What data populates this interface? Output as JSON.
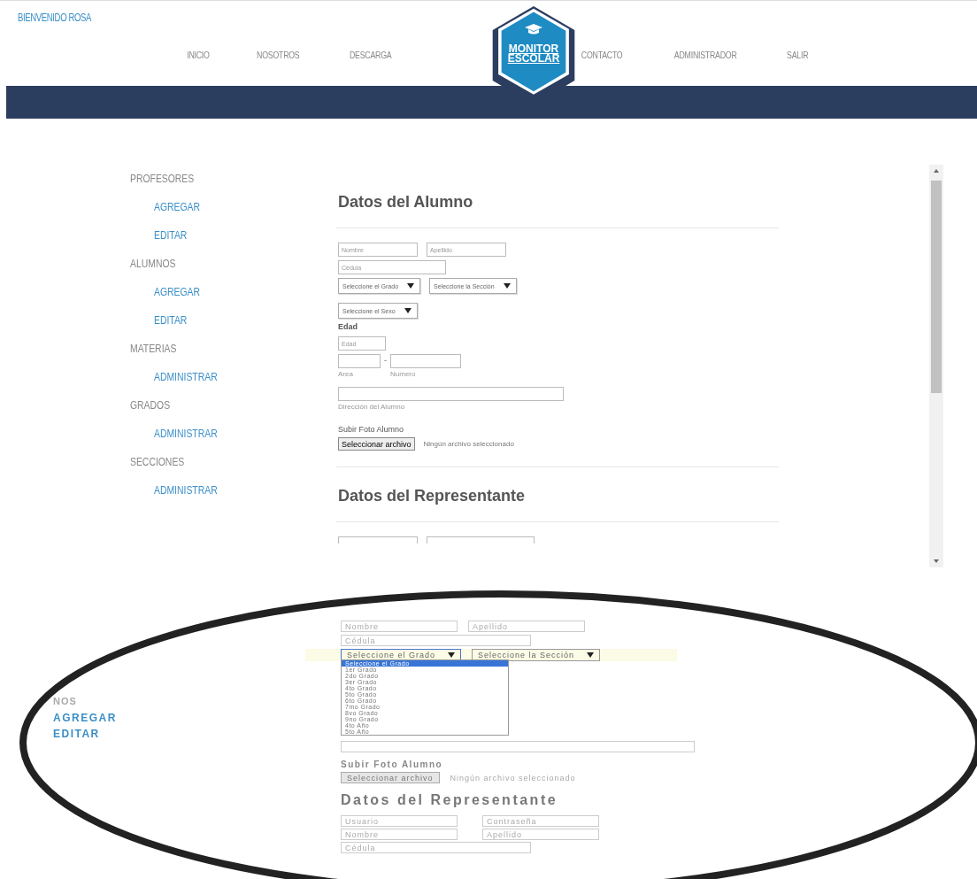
{
  "header": {
    "greeting": "BIENVENIDO ROSA",
    "nav_left": [
      {
        "label": "INICIO"
      },
      {
        "label": "NOSOTROS"
      },
      {
        "label": "DESCARGA"
      }
    ],
    "logo": {
      "line1": "MONITOR",
      "line2": "ESCOLAR"
    },
    "nav_right": [
      {
        "label": "CONTACTO"
      },
      {
        "label": "ADMINISTRADOR"
      },
      {
        "label": "SALIR"
      }
    ]
  },
  "sidebar": [
    {
      "label": "PROFESORES",
      "children": [
        {
          "label": "AGREGAR"
        },
        {
          "label": "EDITAR"
        }
      ]
    },
    {
      "label": "ALUMNOS",
      "children": [
        {
          "label": "AGREGAR"
        },
        {
          "label": "EDITAR"
        }
      ]
    },
    {
      "label": "MATERIAS",
      "children": [
        {
          "label": "ADMINISTRAR"
        }
      ]
    },
    {
      "label": "GRADOS",
      "children": [
        {
          "label": "ADMINISTRAR"
        }
      ]
    },
    {
      "label": "SECCIONES",
      "children": [
        {
          "label": "ADMINISTRAR"
        }
      ]
    }
  ],
  "form": {
    "student_title": "Datos del Alumno",
    "name_fields": [
      {
        "placeholder": "Nombre"
      },
      {
        "placeholder": "Apellido"
      }
    ],
    "id_field": {
      "placeholder": "Cédula"
    },
    "selects": [
      {
        "value": "Seleccione el Grado"
      },
      {
        "value": "Seleccione la Sección"
      }
    ],
    "sex_select": {
      "value": "Seleccione el Sexo"
    },
    "age_label": "Edad",
    "age_field": {
      "placeholder": "Edad"
    },
    "phone_fields": [
      {
        "caption": "Area"
      },
      {
        "caption": "Numero"
      }
    ],
    "phone_separator": "-",
    "address_field": {
      "caption": "Dirección del Alumno"
    },
    "photo_label": "Subir Foto Alumno",
    "file_button": "Seleccionar archivo",
    "file_status": "Ningún archivo seleccionado",
    "rep_title": "Datos del Representante"
  },
  "callout": {
    "sidebar_items": [
      {
        "label": "NOS",
        "kind": "section"
      },
      {
        "label": "AGREGAR",
        "kind": "link"
      },
      {
        "label": "EDITAR",
        "kind": "link"
      }
    ],
    "name_fields": [
      {
        "placeholder": "Nombre"
      },
      {
        "placeholder": "Apellido"
      }
    ],
    "id_field": {
      "placeholder": "Cédula"
    },
    "selects": [
      {
        "value": "Seleccione el Grado",
        "expanded": true
      },
      {
        "value": "Seleccione la Sección",
        "expanded": false
      }
    ],
    "options": [
      {
        "label": "Seleccione el Grado",
        "selected": true
      },
      {
        "label": "1er Grado",
        "selected": false
      },
      {
        "label": "2do Grado",
        "selected": false
      },
      {
        "label": "3er Grado",
        "selected": false
      },
      {
        "label": "4to Grado",
        "selected": false
      },
      {
        "label": "5to Grado",
        "selected": false
      },
      {
        "label": "6to Grado",
        "selected": false
      },
      {
        "label": "7mo Grado",
        "selected": false
      },
      {
        "label": "8vo Grado",
        "selected": false
      },
      {
        "label": "9no Grado",
        "selected": false
      },
      {
        "label": "4to Año",
        "selected": false
      },
      {
        "label": "5to Año",
        "selected": false
      }
    ],
    "photo_label": "Subir Foto Alumno",
    "file_button": "Seleccionar archivo",
    "file_status": "Ningún archivo seleccionado",
    "rep_title": "Datos del Representante",
    "rep_fields": [
      {
        "placeholder": "Usuario"
      },
      {
        "placeholder": "Contraseña"
      },
      {
        "placeholder": "Nombre"
      },
      {
        "placeholder": "Apellido"
      }
    ],
    "rep_id_field": {
      "placeholder": "Cédula"
    }
  }
}
